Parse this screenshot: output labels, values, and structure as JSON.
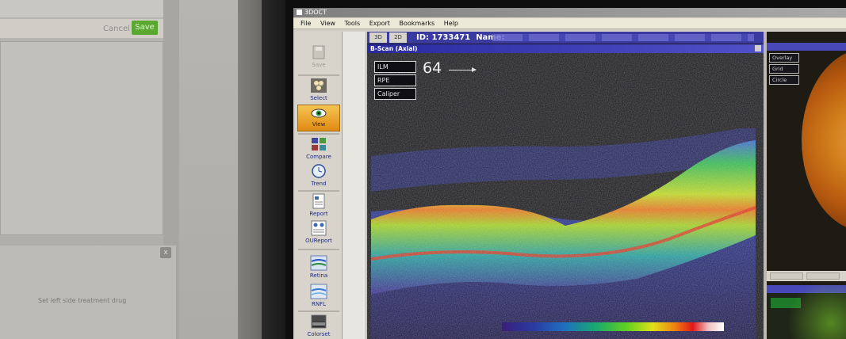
{
  "left_monitor": {
    "cancel_label": "Cancel",
    "save_label": "Save",
    "note_text": "Set left side treatment drug",
    "corner_button": "x"
  },
  "app": {
    "title": "3DOCT",
    "menu": [
      "File",
      "View",
      "Tools",
      "Export",
      "Bookmarks",
      "Help"
    ]
  },
  "toolbar": {
    "items": [
      {
        "label": "Save",
        "icon": "disk-icon",
        "state": "disabled"
      },
      {
        "label": "Select",
        "icon": "select-icon",
        "state": "normal"
      },
      {
        "label": "View",
        "icon": "eye-icon",
        "state": "active"
      },
      {
        "label": "Compare",
        "icon": "compare-grid-icon",
        "state": "normal"
      },
      {
        "label": "Trend",
        "icon": "clock-icon",
        "state": "normal"
      },
      {
        "label": "Report",
        "icon": "report-icon",
        "state": "normal"
      },
      {
        "label": "OUReport",
        "icon": "ou-report-icon",
        "state": "normal"
      },
      {
        "label": "Retina",
        "icon": "retina-layers-icon",
        "state": "normal"
      },
      {
        "label": "RNFL",
        "icon": "rnfl-icon",
        "state": "normal"
      },
      {
        "label": "Colorset",
        "icon": "colorset-icon",
        "state": "normal"
      }
    ]
  },
  "viewer": {
    "tabs": [
      "3D",
      "2D"
    ],
    "id_text": "ID: 1733471",
    "name_label": "Name:",
    "bscan_title": "B-Scan (Axial)",
    "legend": [
      "ILM",
      "RPE",
      "Caliper"
    ],
    "caliper_value": "64"
  },
  "fundus": {
    "overlay_buttons": [
      "Overlay",
      "Grid",
      "Circle"
    ]
  },
  "colors": {
    "accent_blue": "#3a3aa0",
    "active_orange": "#e08a12",
    "save_green": "#5aa830"
  }
}
